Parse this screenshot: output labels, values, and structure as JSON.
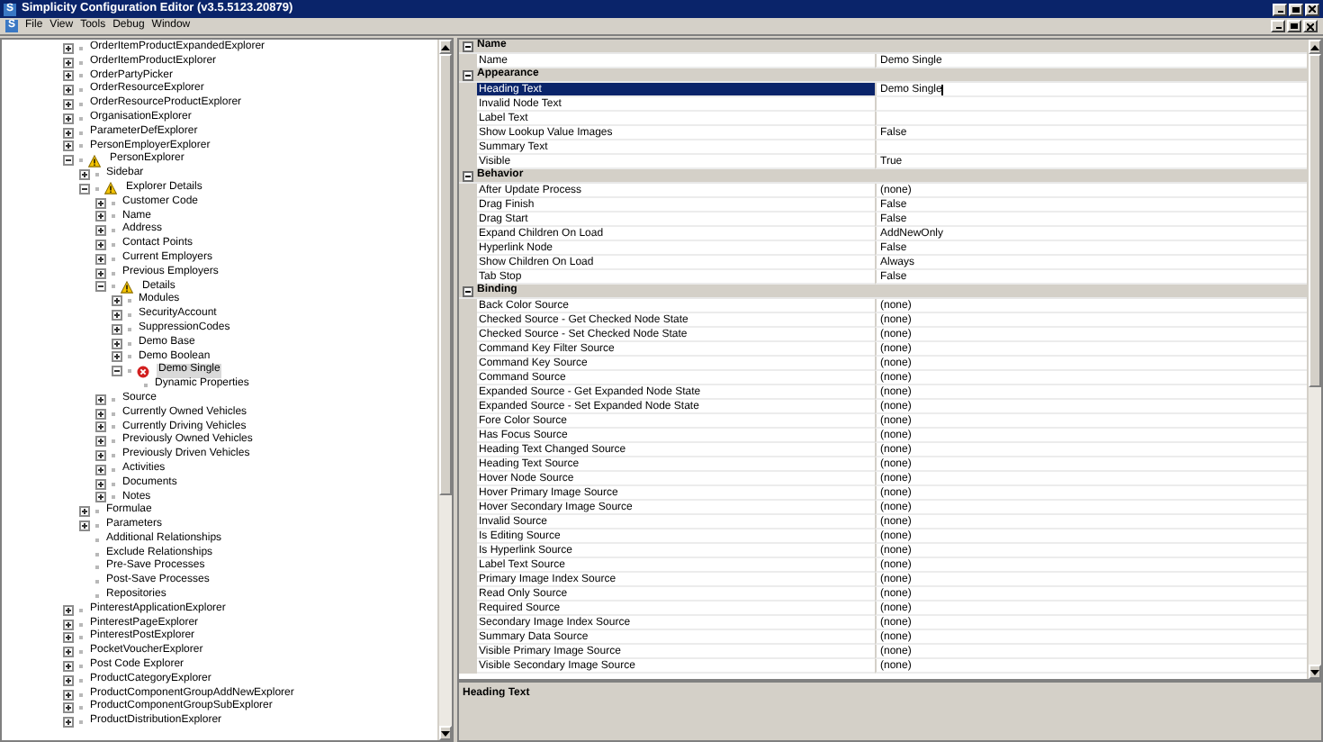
{
  "window": {
    "title": "Simplicity Configuration Editor (v3.5.5123.20879)",
    "icon_letter": "S"
  },
  "menu_bar": {
    "icon_letter": "S",
    "items": [
      "File",
      "View",
      "Tools",
      "Debug",
      "Window"
    ]
  },
  "tree": [
    {
      "label": "OrderItemProductExpandedExplorer",
      "expanded": false,
      "selected": false
    },
    {
      "label": "OrderItemProductExplorer",
      "expanded": false,
      "selected": false
    },
    {
      "label": "OrderPartyPicker",
      "expanded": false,
      "selected": false
    },
    {
      "label": "OrderResourceExplorer",
      "expanded": false,
      "selected": false
    },
    {
      "label": "OrderResourceProductExplorer",
      "expanded": false,
      "selected": false
    },
    {
      "label": "OrganisationExplorer",
      "expanded": false,
      "selected": false
    },
    {
      "label": "ParameterDefExplorer",
      "expanded": false,
      "selected": false
    },
    {
      "label": "PersonEmployerExplorer",
      "expanded": false,
      "selected": false
    },
    {
      "label": "PersonExplorer",
      "expanded": true,
      "selected": false,
      "kind": "warning",
      "children": [
        {
          "label": "Sidebar",
          "expanded": false,
          "selected": false
        },
        {
          "label": "Explorer Details",
          "expanded": true,
          "selected": false,
          "kind": "warning",
          "children": [
            {
              "label": "Customer Code",
              "expanded": false,
              "selected": false
            },
            {
              "label": "Name",
              "expanded": false,
              "selected": false
            },
            {
              "label": "Address",
              "expanded": false,
              "selected": false
            },
            {
              "label": "Contact Points",
              "expanded": false,
              "selected": false
            },
            {
              "label": "Current Employers",
              "expanded": false,
              "selected": false
            },
            {
              "label": "Previous Employers",
              "expanded": false,
              "selected": false
            },
            {
              "label": "Details",
              "expanded": true,
              "selected": false,
              "kind": "warning",
              "children": [
                {
                  "label": "Modules",
                  "expanded": false,
                  "selected": false
                },
                {
                  "label": "SecurityAccount",
                  "expanded": false,
                  "selected": false
                },
                {
                  "label": "SuppressionCodes",
                  "expanded": false,
                  "selected": false
                },
                {
                  "label": "Demo Base",
                  "expanded": false,
                  "selected": false
                },
                {
                  "label": "Demo Boolean",
                  "expanded": false,
                  "selected": false
                },
                {
                  "label": "Demo Single",
                  "expanded": true,
                  "selected": true,
                  "kind": "error",
                  "children": [
                    {
                      "label": "Dynamic Properties",
                      "selected": false
                    }
                  ]
                }
              ]
            },
            {
              "label": "Source",
              "expanded": false,
              "selected": false
            },
            {
              "label": "Currently Owned Vehicles",
              "expanded": false,
              "selected": false
            },
            {
              "label": "Currently Driving Vehicles",
              "expanded": false,
              "selected": false
            },
            {
              "label": "Previously Owned Vehicles",
              "expanded": false,
              "selected": false
            },
            {
              "label": "Previously Driven Vehicles",
              "expanded": false,
              "selected": false
            },
            {
              "label": "Activities",
              "expanded": false,
              "selected": false
            },
            {
              "label": "Documents",
              "expanded": false,
              "selected": false
            },
            {
              "label": "Notes",
              "expanded": false,
              "selected": false
            }
          ]
        },
        {
          "label": "Formulae",
          "expanded": false,
          "selected": false
        },
        {
          "label": "Parameters",
          "expanded": false,
          "selected": false
        },
        {
          "label": "Additional Relationships",
          "selected": false
        },
        {
          "label": "Exclude Relationships",
          "selected": false
        },
        {
          "label": "Pre-Save Processes",
          "selected": false
        },
        {
          "label": "Post-Save Processes",
          "selected": false
        },
        {
          "label": "Repositories",
          "selected": false
        }
      ]
    },
    {
      "label": "PinterestApplicationExplorer",
      "expanded": false,
      "selected": false
    },
    {
      "label": "PinterestPageExplorer",
      "expanded": false,
      "selected": false
    },
    {
      "label": "PinterestPostExplorer",
      "expanded": false,
      "selected": false
    },
    {
      "label": "PocketVoucherExplorer",
      "expanded": false,
      "selected": false
    },
    {
      "label": "Post Code Explorer",
      "expanded": false,
      "selected": false
    },
    {
      "label": "ProductCategoryExplorer",
      "expanded": false,
      "selected": false
    },
    {
      "label": "ProductComponentGroupAddNewExplorer",
      "expanded": false,
      "selected": false
    },
    {
      "label": "ProductComponentGroupSubExplorer",
      "expanded": false,
      "selected": false
    },
    {
      "label": "ProductDistributionExplorer",
      "expanded": false,
      "selected": false
    }
  ],
  "property_grid": {
    "categories": [
      {
        "name": "Name",
        "expanded": true,
        "properties": [
          {
            "name": "Name",
            "value": "Demo Single",
            "selected": false
          }
        ]
      },
      {
        "name": "Appearance",
        "expanded": true,
        "properties": [
          {
            "name": "Heading Text",
            "value": "Demo Single",
            "selected": true
          },
          {
            "name": "Invalid Node Text",
            "selected": false
          },
          {
            "name": "Label Text",
            "selected": false
          },
          {
            "name": "Show Lookup Value Images",
            "value": "False",
            "selected": false
          },
          {
            "name": "Summary Text",
            "selected": false
          },
          {
            "name": "Visible",
            "value": "True",
            "selected": false
          }
        ]
      },
      {
        "name": "Behavior",
        "expanded": true,
        "properties": [
          {
            "name": "After Update Process",
            "value": "(none)",
            "selected": false
          },
          {
            "name": "Drag Finish",
            "value": "False",
            "selected": false
          },
          {
            "name": "Drag Start",
            "value": "False",
            "selected": false
          },
          {
            "name": "Expand Children On Load",
            "value": "AddNewOnly",
            "selected": false
          },
          {
            "name": "Hyperlink Node",
            "value": "False",
            "selected": false
          },
          {
            "name": "Show Children On Load",
            "value": "Always",
            "selected": false
          },
          {
            "name": "Tab Stop",
            "value": "False",
            "selected": false
          }
        ]
      },
      {
        "name": "Binding",
        "expanded": true,
        "properties": [
          {
            "name": "Back Color Source",
            "value": "(none)",
            "selected": false
          },
          {
            "name": "Checked Source - Get Checked Node State",
            "value": "(none)",
            "selected": false
          },
          {
            "name": "Checked Source - Set Checked Node State",
            "value": "(none)",
            "selected": false
          },
          {
            "name": "Command Key Filter Source",
            "value": "(none)",
            "selected": false
          },
          {
            "name": "Command Key Source",
            "value": "(none)",
            "selected": false
          },
          {
            "name": "Command Source",
            "value": "(none)",
            "selected": false
          },
          {
            "name": "Expanded Source - Get Expanded Node State",
            "value": "(none)",
            "selected": false
          },
          {
            "name": "Expanded Source - Set Expanded Node State",
            "value": "(none)",
            "selected": false
          },
          {
            "name": "Fore Color Source",
            "value": "(none)",
            "selected": false
          },
          {
            "name": "Has Focus Source",
            "value": "(none)",
            "selected": false
          },
          {
            "name": "Heading Text Changed Source",
            "value": "(none)",
            "selected": false
          },
          {
            "name": "Heading Text Source",
            "value": "(none)",
            "selected": false
          },
          {
            "name": "Hover Node Source",
            "value": "(none)",
            "selected": false
          },
          {
            "name": "Hover Primary Image Source",
            "value": "(none)",
            "selected": false
          },
          {
            "name": "Hover Secondary Image Source",
            "value": "(none)",
            "selected": false
          },
          {
            "name": "Invalid Source",
            "value": "(none)",
            "selected": false
          },
          {
            "name": "Is Editing Source",
            "value": "(none)",
            "selected": false
          },
          {
            "name": "Is Hyperlink Source",
            "value": "(none)",
            "selected": false
          },
          {
            "name": "Label Text Source",
            "value": "(none)",
            "selected": false
          },
          {
            "name": "Primary Image Index Source",
            "value": "(none)",
            "selected": false
          },
          {
            "name": "Read Only Source",
            "value": "(none)",
            "selected": false
          },
          {
            "name": "Required Source",
            "value": "(none)",
            "selected": false
          },
          {
            "name": "Secondary Image Index Source",
            "value": "(none)",
            "selected": false
          },
          {
            "name": "Summary Data Source",
            "value": "(none)",
            "selected": false
          },
          {
            "name": "Visible Primary Image Source",
            "value": "(none)",
            "selected": false
          },
          {
            "name": "Visible Secondary Image Source",
            "value": "(none)",
            "selected": false
          }
        ]
      }
    ],
    "description": {
      "title": "Heading Text"
    }
  }
}
